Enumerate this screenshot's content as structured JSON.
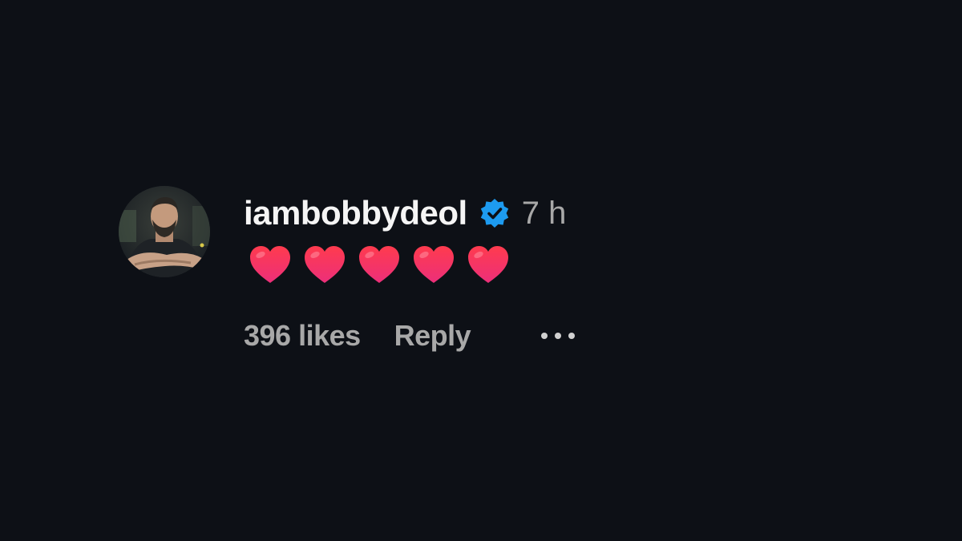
{
  "comment": {
    "username": "iambobbydeol",
    "verified_icon": "verified-badge-icon",
    "timestamp": "7 h",
    "body_icons": [
      "red-heart-icon",
      "red-heart-icon",
      "red-heart-icon",
      "red-heart-icon",
      "red-heart-icon"
    ],
    "likes_label": "396 likes",
    "reply_label": "Reply",
    "more_icon": "more-options-icon"
  },
  "colors": {
    "background": "#0d1016",
    "username": "#f5f5f5",
    "secondary_text": "#a8a8a8",
    "verified_blue": "#1d9bf0",
    "heart_red": "#f0304f"
  }
}
